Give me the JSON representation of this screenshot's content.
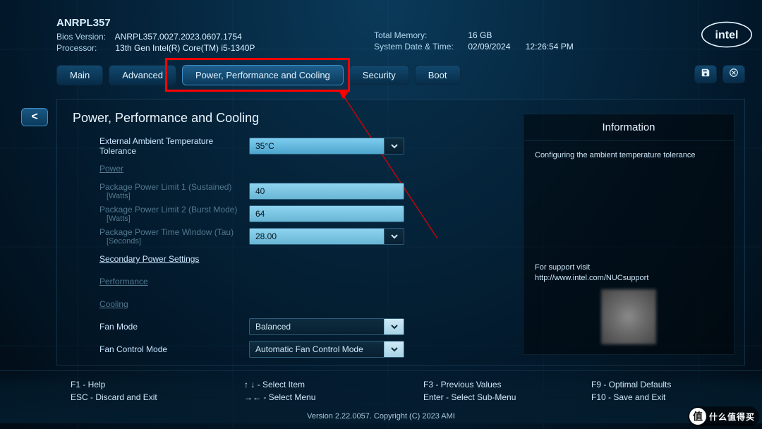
{
  "header": {
    "product": "ANRPL357",
    "bios_label": "Bios Version:",
    "bios_value": "ANRPL357.0027.2023.0607.1754",
    "processor_label": "Processor:",
    "processor_value": "13th Gen Intel(R) Core(TM) i5-1340P",
    "total_memory_label": "Total Memory:",
    "total_memory_value": "16 GB",
    "datetime_label": "System Date & Time:",
    "date_value": "02/09/2024",
    "time_value": "12:26:54 PM",
    "logo_text": "intel"
  },
  "tabs": {
    "items": [
      "Main",
      "Advanced",
      "Power, Performance and Cooling",
      "Security",
      "Boot"
    ],
    "active_index": 2
  },
  "back_label": "<",
  "page": {
    "title": "Power, Performance and Cooling",
    "fields": {
      "ext_temp_label": "External Ambient Temperature Tolerance",
      "ext_temp_value": "35°C",
      "power_section": "Power",
      "ppl1_label": "Package Power Limit 1 (Sustained)",
      "ppl1_sub": "[Watts]",
      "ppl1_value": "40",
      "ppl2_label": "Package Power Limit 2 (Burst Mode)",
      "ppl2_sub": "[Watts]",
      "ppl2_value": "64",
      "pptw_label": "Package Power Time Window (Tau)",
      "pptw_sub": "[Seconds]",
      "pptw_value": "28.00",
      "secondary_power": "Secondary Power Settings",
      "performance_section": "Performance",
      "cooling_section": "Cooling",
      "fan_mode_label": "Fan Mode",
      "fan_mode_value": "Balanced",
      "fan_ctrl_label": "Fan Control Mode",
      "fan_ctrl_value": "Automatic Fan Control Mode"
    },
    "info": {
      "title": "Information",
      "body": "Configuring the ambient temperature tolerance",
      "support_label": "For support visit",
      "support_url": "http://www.intel.com/NUCsupport"
    }
  },
  "footer": {
    "k1a": "F1 - Help",
    "k1b": "ESC - Discard and Exit",
    "k2a": "↑ ↓ - Select Item",
    "k2b": "→← - Select Menu",
    "k3a": "F3 - Previous Values",
    "k3b": "Enter - Select Sub-Menu",
    "k4a": "F9 - Optimal Defaults",
    "k4b": "F10 - Save and Exit",
    "version": "Version 2.22.0057. Copyright (C) 2023 AMI"
  },
  "watermark": {
    "glyph": "值",
    "text": "什么值得买"
  }
}
